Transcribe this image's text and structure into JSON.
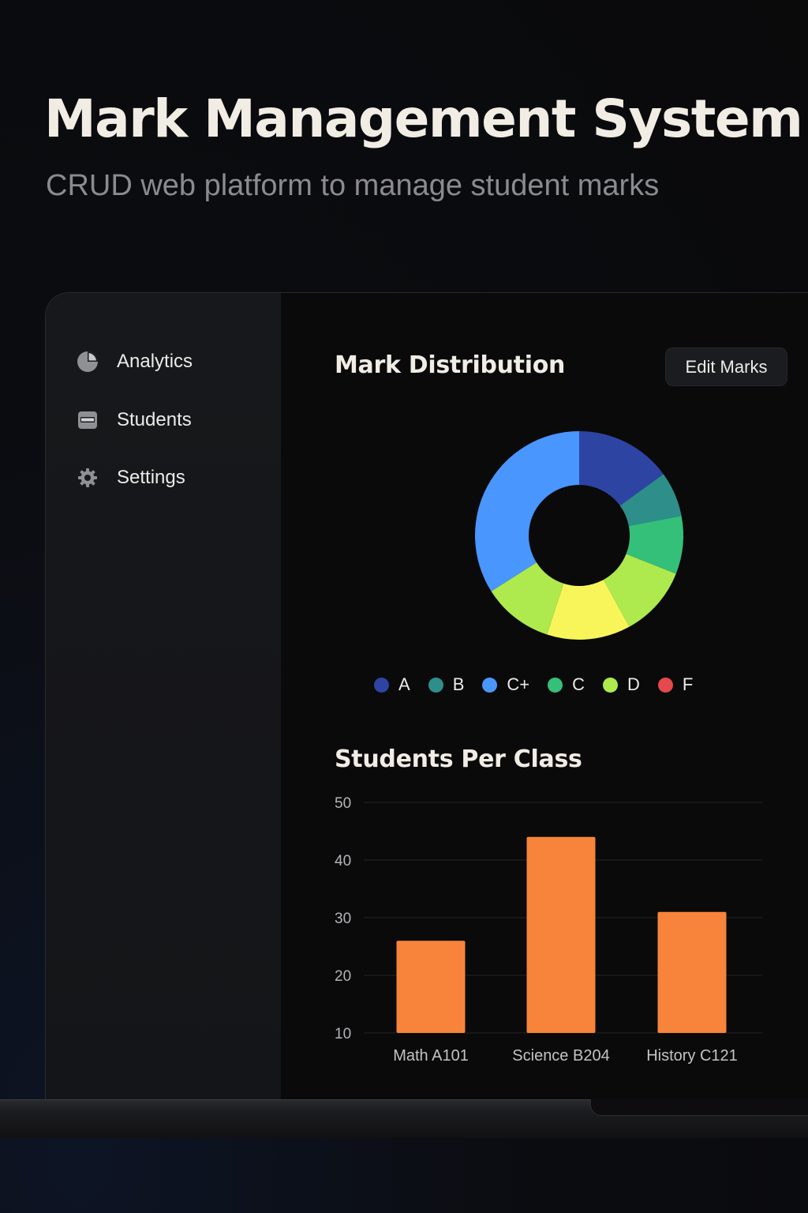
{
  "hero": {
    "title": "Mark Management System",
    "subtitle": "CRUD web platform to manage student marks"
  },
  "sidebar": {
    "items": [
      {
        "label": "Analytics",
        "icon": "pie-chart-icon"
      },
      {
        "label": "Students",
        "icon": "id-card-icon"
      },
      {
        "label": "Settings",
        "icon": "gear-icon"
      }
    ]
  },
  "main": {
    "distribution_title": "Mark Distribution",
    "edit_button": "Edit Marks",
    "class_title": "Students Per Class"
  },
  "colors": {
    "A": "#2e44a3",
    "B": "#2e8f8a",
    "C+": "#4a96ff",
    "C": "#34c079",
    "D": "#aeea4d",
    "F": "#e5484d",
    "yellow": "#f7f55a",
    "bar": "#f7843a"
  },
  "chart_data": [
    {
      "type": "pie",
      "title": "Mark Distribution",
      "legend": [
        "A",
        "B",
        "C+",
        "C",
        "D",
        "F"
      ],
      "slices": [
        {
          "color": "#2e44a3",
          "value": 15
        },
        {
          "color": "#2e8f8a",
          "value": 7
        },
        {
          "color": "#34c079",
          "value": 9
        },
        {
          "color": "#aeea4d",
          "value": 11
        },
        {
          "color": "#f7f55a",
          "value": 13
        },
        {
          "color": "#aeea4d",
          "value": 11
        },
        {
          "color": "#4a96ff",
          "value": 34
        }
      ]
    },
    {
      "type": "bar",
      "title": "Students Per Class",
      "categories": [
        "Math A101",
        "Science B204",
        "History C121"
      ],
      "values": [
        26,
        44,
        31
      ],
      "ylim": [
        10,
        50
      ],
      "yticks": [
        50,
        40,
        30,
        20,
        10
      ],
      "grid": true
    }
  ]
}
